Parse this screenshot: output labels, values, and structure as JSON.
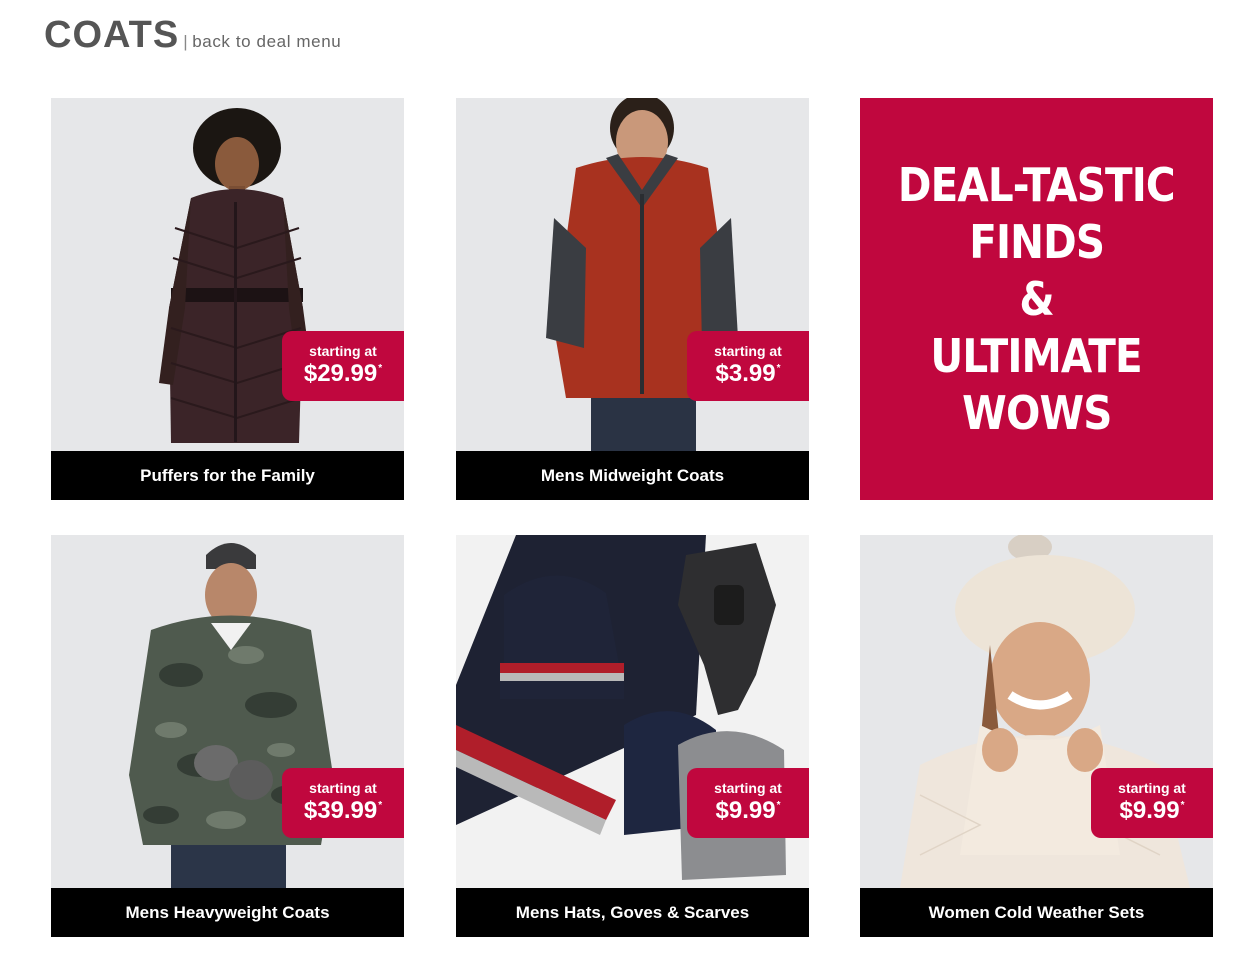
{
  "header": {
    "title": "COATS",
    "separator": "|",
    "back_link": "back to deal menu"
  },
  "tiles": [
    {
      "caption": "Puffers for the Family",
      "price_label": "starting at",
      "price": "$29.99",
      "asterisk": "*"
    },
    {
      "caption": "Mens Midweight Coats",
      "price_label": "starting at",
      "price": "$3.99",
      "asterisk": "*"
    },
    {
      "caption": "Mens Heavyweight Coats",
      "price_label": "starting at",
      "price": "$39.99",
      "asterisk": "*"
    },
    {
      "caption": "Mens Hats, Goves & Scarves",
      "price_label": "starting at",
      "price": "$9.99",
      "asterisk": "*"
    },
    {
      "caption": "Women Cold Weather Sets",
      "price_label": "starting at",
      "price": "$9.99",
      "asterisk": "*"
    }
  ],
  "promo": {
    "lines": [
      "DEAL-TASTIC",
      "FINDS",
      "&",
      "ULTIMATE",
      "WOWS"
    ]
  },
  "colors": {
    "accent": "#c0073e",
    "caption_bg": "#000000",
    "title": "#555555"
  }
}
